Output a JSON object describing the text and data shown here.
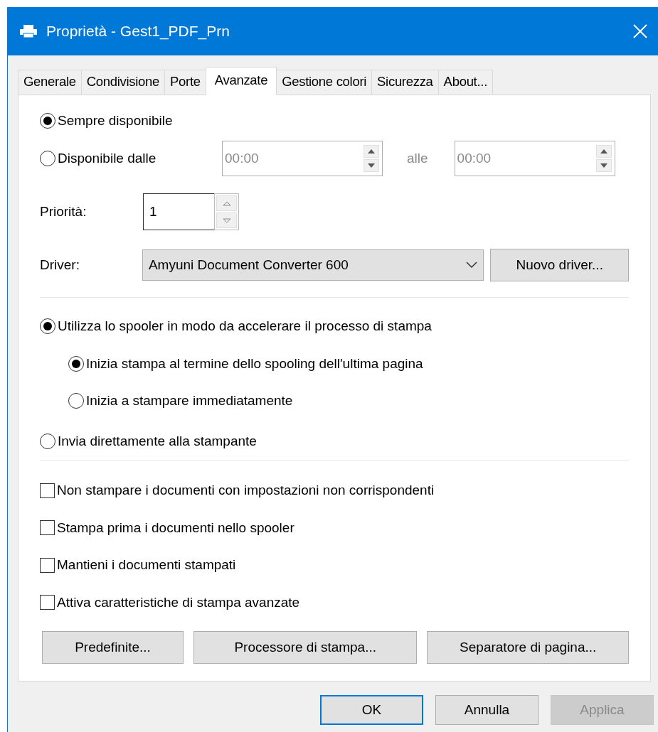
{
  "window": {
    "title": "Proprietà - Gest1_PDF_Prn"
  },
  "tabs": [
    {
      "label": "Generale",
      "selected": false
    },
    {
      "label": "Condivisione",
      "selected": false
    },
    {
      "label": "Porte",
      "selected": false
    },
    {
      "label": "Avanzate",
      "selected": true
    },
    {
      "label": "Gestione colori",
      "selected": false
    },
    {
      "label": "Sicurezza",
      "selected": false
    },
    {
      "label": "About...",
      "selected": false
    }
  ],
  "availability": [
    {
      "label": "Sempre disponibile",
      "selected": true
    },
    {
      "label": "Disponibile dalle",
      "selected": false
    }
  ],
  "time_from": {
    "value": "00:00",
    "disabled": true
  },
  "time_separator": "alle",
  "time_to": {
    "value": "00:00",
    "disabled": true
  },
  "priority": {
    "label": "Priorità:",
    "value": "1"
  },
  "driver": {
    "label": "Driver:",
    "value": "Amyuni Document Converter 600",
    "button": "Nuovo driver..."
  },
  "spool_modes": [
    {
      "label": "Utilizza lo spooler in modo da accelerare il processo di stampa",
      "selected": true,
      "children": [
        {
          "label": "Inizia stampa al termine dello spooling dell'ultima pagina",
          "selected": true
        },
        {
          "label": "Inizia a stampare immediatamente",
          "selected": false
        }
      ]
    },
    {
      "label": "Invia direttamente alla stampante",
      "selected": false
    }
  ],
  "checkboxes": [
    {
      "label": "Non stampare i documenti con impostazioni non corrispondenti",
      "checked": false
    },
    {
      "label": "Stampa prima i documenti nello spooler",
      "checked": false
    },
    {
      "label": "Mantieni i documenti stampati",
      "checked": false
    },
    {
      "label": "Attiva caratteristiche di stampa avanzate",
      "checked": false
    }
  ],
  "panel_buttons": [
    "Predefinite...",
    "Processore di stampa...",
    "Separatore di pagina..."
  ],
  "dialog_buttons": [
    {
      "label": "OK",
      "default": true,
      "disabled": false
    },
    {
      "label": "Annulla",
      "default": false,
      "disabled": false
    },
    {
      "label": "Applica",
      "default": false,
      "disabled": true
    }
  ]
}
